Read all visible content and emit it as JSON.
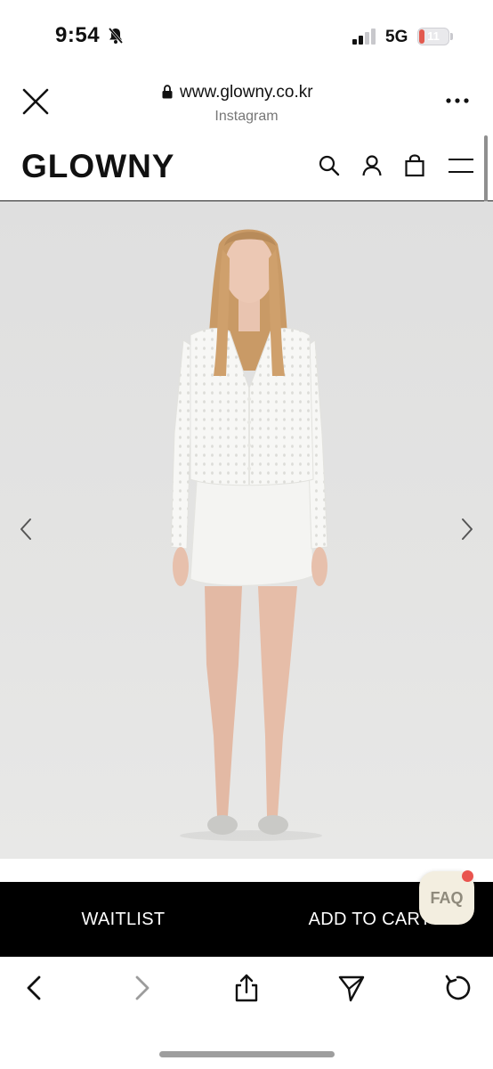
{
  "status_bar": {
    "time": "9:54",
    "network": "5G",
    "battery_level": "11",
    "battery_fraction": 0.11,
    "icons": [
      "bell-slash-icon",
      "signal-icon"
    ]
  },
  "browser": {
    "url": "www.glowny.co.kr",
    "source": "Instagram",
    "icons": [
      "close-icon",
      "lock-icon",
      "more-icon"
    ]
  },
  "site_header": {
    "logo": "GLOWNY",
    "icons": [
      "search-icon",
      "account-icon",
      "bag-icon",
      "menu-icon"
    ]
  },
  "product": {
    "icons": [
      "chevron-left-icon",
      "chevron-right-icon"
    ]
  },
  "cart_bar": {
    "waitlist_label": "WAITLIST",
    "add_to_cart_label": "ADD TO CART"
  },
  "faq": {
    "label": "FAQ"
  },
  "toolbar": {
    "icons": [
      "back-icon",
      "forward-icon",
      "share-icon",
      "send-icon",
      "reload-icon"
    ]
  },
  "colors": {
    "accent_red": "#e9544e",
    "bar_black": "#000000",
    "faq_bg": "#f3eee0"
  }
}
